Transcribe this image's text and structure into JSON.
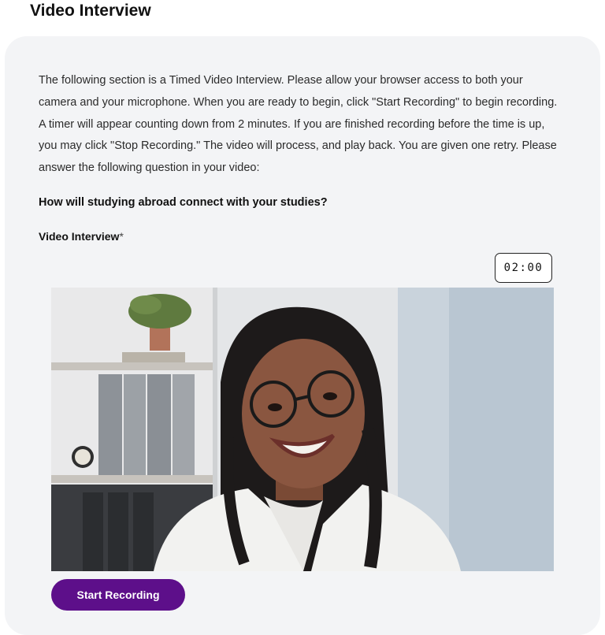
{
  "page": {
    "title": "Video Interview"
  },
  "intro": {
    "text": "The following section is a Timed Video Interview. Please allow your browser access to both your camera and your microphone. When you are ready to begin, click \"Start Recording\" to begin recording. A timer will appear counting down from 2 minutes. If you are finished recording before the time is up, you may click \"Stop Recording.\" The video will process, and play back. You are given one retry. Please answer the following question in your video:"
  },
  "question": {
    "text": "How will studying abroad connect with your studies?"
  },
  "field": {
    "label": "Video Interview",
    "required_mark": "*"
  },
  "timer": {
    "value": "02:00"
  },
  "video": {
    "description_icon": "webcam-preview"
  },
  "actions": {
    "start_label": "Start Recording"
  },
  "colors": {
    "accent": "#5d0f8a",
    "card_bg": "#f3f4f6"
  }
}
